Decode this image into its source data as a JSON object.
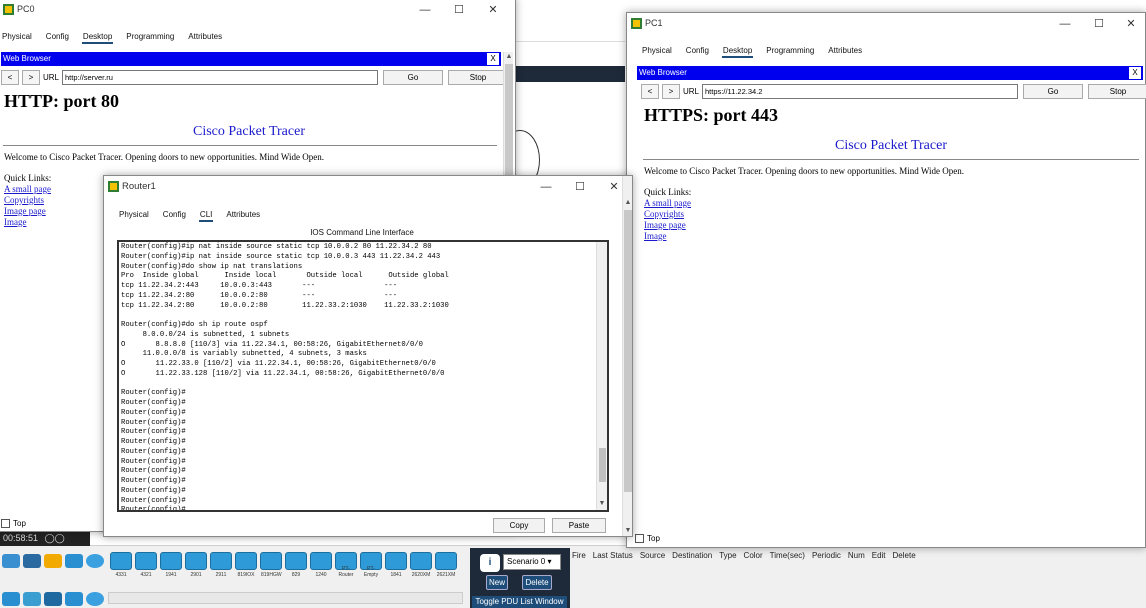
{
  "pc0": {
    "title": "PC0",
    "tabs": [
      "Physical",
      "Config",
      "Desktop",
      "Programming",
      "Attributes"
    ],
    "active_tab": "Desktop",
    "browser": {
      "header": "Web Browser",
      "close": "X",
      "back": "<",
      "forward": ">",
      "url_label": "URL",
      "url_value": "http://server.ru",
      "go": "Go",
      "stop": "Stop"
    },
    "page": {
      "heading": "HTTP: port 80",
      "brand": "Cisco Packet Tracer",
      "welcome": "Welcome to Cisco Packet Tracer. Opening doors to new opportunities. Mind Wide Open.",
      "quick_links_label": "Quick Links:",
      "links": [
        "A small page",
        "Copyrights",
        "Image page",
        "Image"
      ]
    },
    "top_label": "Top"
  },
  "pc1": {
    "title": "PC1",
    "tabs": [
      "Physical",
      "Config",
      "Desktop",
      "Programming",
      "Attributes"
    ],
    "active_tab": "Desktop",
    "browser": {
      "header": "Web Browser",
      "close": "X",
      "back": "<",
      "forward": ">",
      "url_label": "URL",
      "url_value": "https://11.22.34.2",
      "go": "Go",
      "stop": "Stop"
    },
    "page": {
      "heading": "HTTPS: port 443",
      "brand": "Cisco Packet Tracer",
      "welcome": "Welcome to Cisco Packet Tracer. Opening doors to new opportunities. Mind Wide Open.",
      "quick_links_label": "Quick Links:",
      "links": [
        "A small page",
        "Copyrights",
        "Image page",
        "Image"
      ]
    },
    "top_label": "Top"
  },
  "router": {
    "title": "Router1",
    "tabs": [
      "Physical",
      "Config",
      "CLI",
      "Attributes"
    ],
    "active_tab": "CLI",
    "cli_title": "IOS Command Line Interface",
    "cli_lines": [
      "Router(config)#ip nat inside source static tcp 10.0.0.2 80 11.22.34.2 80",
      "Router(config)#ip nat inside source static tcp 10.0.0.3 443 11.22.34.2 443",
      "Router(config)#do show ip nat translations",
      "Pro  Inside global      Inside local       Outside local      Outside global",
      "tcp 11.22.34.2:443     10.0.0.3:443       ---                ---",
      "tcp 11.22.34.2:80      10.0.0.2:80        ---                ---",
      "tcp 11.22.34.2:80      10.0.0.2:80        11.22.33.2:1030    11.22.33.2:1030",
      "",
      "Router(config)#do sh ip route ospf",
      "     8.0.0.0/24 is subnetted, 1 subnets",
      "O       8.8.8.0 [110/3] via 11.22.34.1, 00:58:26, GigabitEthernet0/0/0",
      "     11.0.0.0/8 is variably subnetted, 4 subnets, 3 masks",
      "O       11.22.33.0 [110/2] via 11.22.34.1, 00:58:26, GigabitEthernet0/0/0",
      "O       11.22.33.128 [110/2] via 11.22.34.1, 00:58:26, GigabitEthernet0/0/0",
      "",
      "Router(config)#",
      "Router(config)#",
      "Router(config)#",
      "Router(config)#",
      "Router(config)#",
      "Router(config)#",
      "Router(config)#",
      "Router(config)#",
      "Router(config)#",
      "Router(config)#",
      "Router(config)#",
      "Router(config)#",
      "Router(config)#"
    ],
    "copy": "Copy",
    "paste": "Paste"
  },
  "bottom": {
    "clock": "00:58:51",
    "scenario": "Scenario 0",
    "new_btn": "New",
    "delete_btn": "Delete",
    "toggle_pdu": "Toggle PDU List Window",
    "pdu_columns": [
      "Fire",
      "Last Status",
      "Source",
      "Destination",
      "Type",
      "Color",
      "Time(sec)",
      "Periodic",
      "Num",
      "Edit",
      "Delete"
    ],
    "device_models": [
      "4331",
      "4321",
      "1941",
      "2901",
      "2911",
      "819IOX",
      "819HGW",
      "829",
      "1240",
      "PT-Router",
      "PT-Empty",
      "1841",
      "2620XM",
      "2621XM"
    ]
  },
  "colors": {
    "browser_header": "#0000ee",
    "link": "#1a1acc",
    "active_tab_underline": "#1e4d7a",
    "pdu_panel": "#1e2a3a"
  }
}
